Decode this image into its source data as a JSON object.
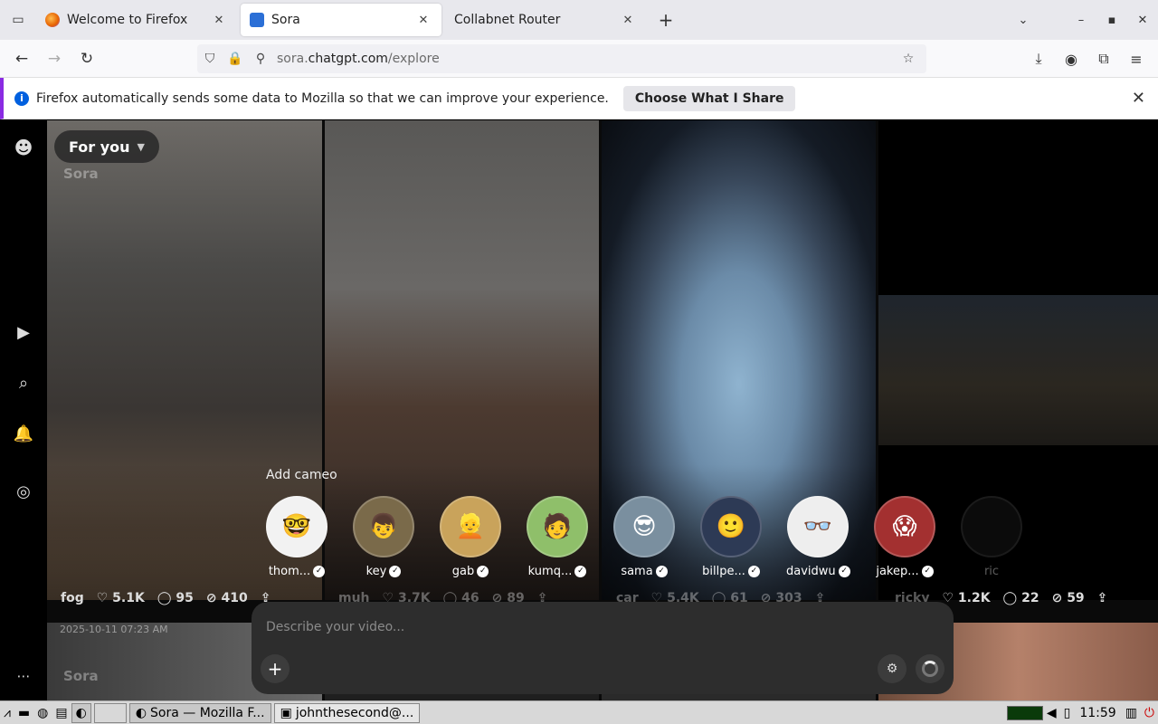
{
  "browser": {
    "tabs": [
      {
        "label": "Welcome to Firefox",
        "active": false,
        "icon": "firefox-icon"
      },
      {
        "label": "Sora",
        "active": true,
        "icon": "sora-icon"
      },
      {
        "label": "Collabnet Router",
        "active": false,
        "icon": ""
      }
    ],
    "url": {
      "prefix": "sora.",
      "domain": "chatgpt.com",
      "path": "/explore"
    },
    "notice": {
      "message": "Firefox automatically sends some data to Mozilla so that we can improve your experience.",
      "button": "Choose What I Share"
    }
  },
  "feed": {
    "filter_label": "For you",
    "watermark": "Sora",
    "cameo_label": "Add cameo",
    "cameos": [
      {
        "name": "thom...",
        "emoji": "🤓",
        "bg": "#f2f2f2"
      },
      {
        "name": "key",
        "emoji": "👦",
        "bg": "#7a6a4a"
      },
      {
        "name": "gab",
        "emoji": "👱",
        "bg": "#c9a35b"
      },
      {
        "name": "kumq...",
        "emoji": "🧑",
        "bg": "#8fbf6a"
      },
      {
        "name": "sama",
        "emoji": "😎",
        "bg": "#7a8f9f"
      },
      {
        "name": "billpe...",
        "emoji": "🙂",
        "bg": "#2d3a55"
      },
      {
        "name": "davidwu",
        "emoji": "👓",
        "bg": "#eeeeee"
      },
      {
        "name": "jakep...",
        "emoji": "😱",
        "bg": "#a33030"
      },
      {
        "name": "ric",
        "emoji": "",
        "bg": "#222222"
      }
    ],
    "videos": [
      {
        "user": "fog",
        "likes": "5.1K",
        "comments": "95",
        "remixes": "410"
      },
      {
        "user": "muh",
        "likes": "3.7K",
        "comments": "46",
        "remixes": "89"
      },
      {
        "user": "car",
        "likes": "5.4K",
        "comments": "61",
        "remixes": "303"
      },
      {
        "user": "ricky",
        "likes": "1.2K",
        "comments": "22",
        "remixes": "59"
      }
    ],
    "date_stamp": "2025-10-11 07:23 AM"
  },
  "composer": {
    "placeholder": "Describe your video..."
  },
  "taskbar": {
    "tasks": [
      "Sora — Mozilla F...",
      "johnthesecond@..."
    ],
    "clock": "11:59"
  }
}
